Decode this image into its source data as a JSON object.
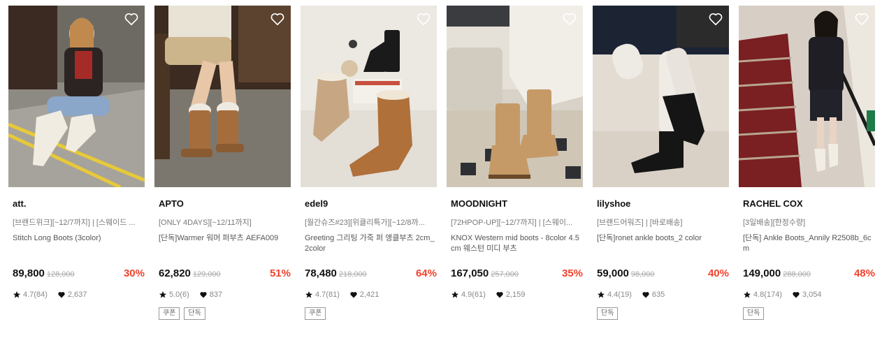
{
  "colors": {
    "discount": "#f0422c",
    "text": "#111111",
    "muted": "#888888"
  },
  "icons": {
    "wishlist": "heart-outline-icon",
    "rating": "star-icon",
    "likes": "heart-filled-icon"
  },
  "products": [
    {
      "brand": "att.",
      "promo": "[브랜드위크][~12/7까지] | [스웨이드 ...",
      "name": "Stitch Long Boots (3color)",
      "price": "89,800",
      "original_price": "128,000",
      "discount": "30%",
      "rating": "4.7(84)",
      "likes": "2,637",
      "tags": []
    },
    {
      "brand": "APTO",
      "promo": "[ONLY 4DAYS][~12/11까지]",
      "name": "[단독]Warmer 워머 퍼부츠 AEFA009",
      "price": "62,820",
      "original_price": "129,000",
      "discount": "51%",
      "rating": "5.0(6)",
      "likes": "837",
      "tags": [
        "쿠폰",
        "단독"
      ]
    },
    {
      "brand": "edel9",
      "promo": "[월간슈즈#23][위클리특가][~12/8까...",
      "name": "Greeting 그리팅 가죽 퍼 앵클부츠 2cm_2color",
      "price": "78,480",
      "original_price": "218,000",
      "discount": "64%",
      "rating": "4.7(81)",
      "likes": "2,421",
      "tags": [
        "쿠폰"
      ]
    },
    {
      "brand": "MOODNIGHT",
      "promo": "[72HPOP-UP][~12/7까지] | [스웨이...",
      "name": "KNOX Western mid boots - 8color 4.5cm 웨스턴 미디 부츠",
      "price": "167,050",
      "original_price": "257,000",
      "discount": "35%",
      "rating": "4.9(61)",
      "likes": "2,159",
      "tags": []
    },
    {
      "brand": "lilyshoe",
      "promo": "[브랜드어워즈] | [바로배송]",
      "name": "[단독]ronet ankle boots_2 color",
      "price": "59,000",
      "original_price": "98,000",
      "discount": "40%",
      "rating": "4.4(19)",
      "likes": "635",
      "tags": [
        "단독"
      ]
    },
    {
      "brand": "RACHEL COX",
      "promo": "[3일배송][한정수량]",
      "name": "[단독] Ankle Boots_Annily R2508b_6cm",
      "price": "149,000",
      "original_price": "288,000",
      "discount": "48%",
      "rating": "4.8(174)",
      "likes": "3,054",
      "tags": [
        "단독"
      ]
    }
  ]
}
